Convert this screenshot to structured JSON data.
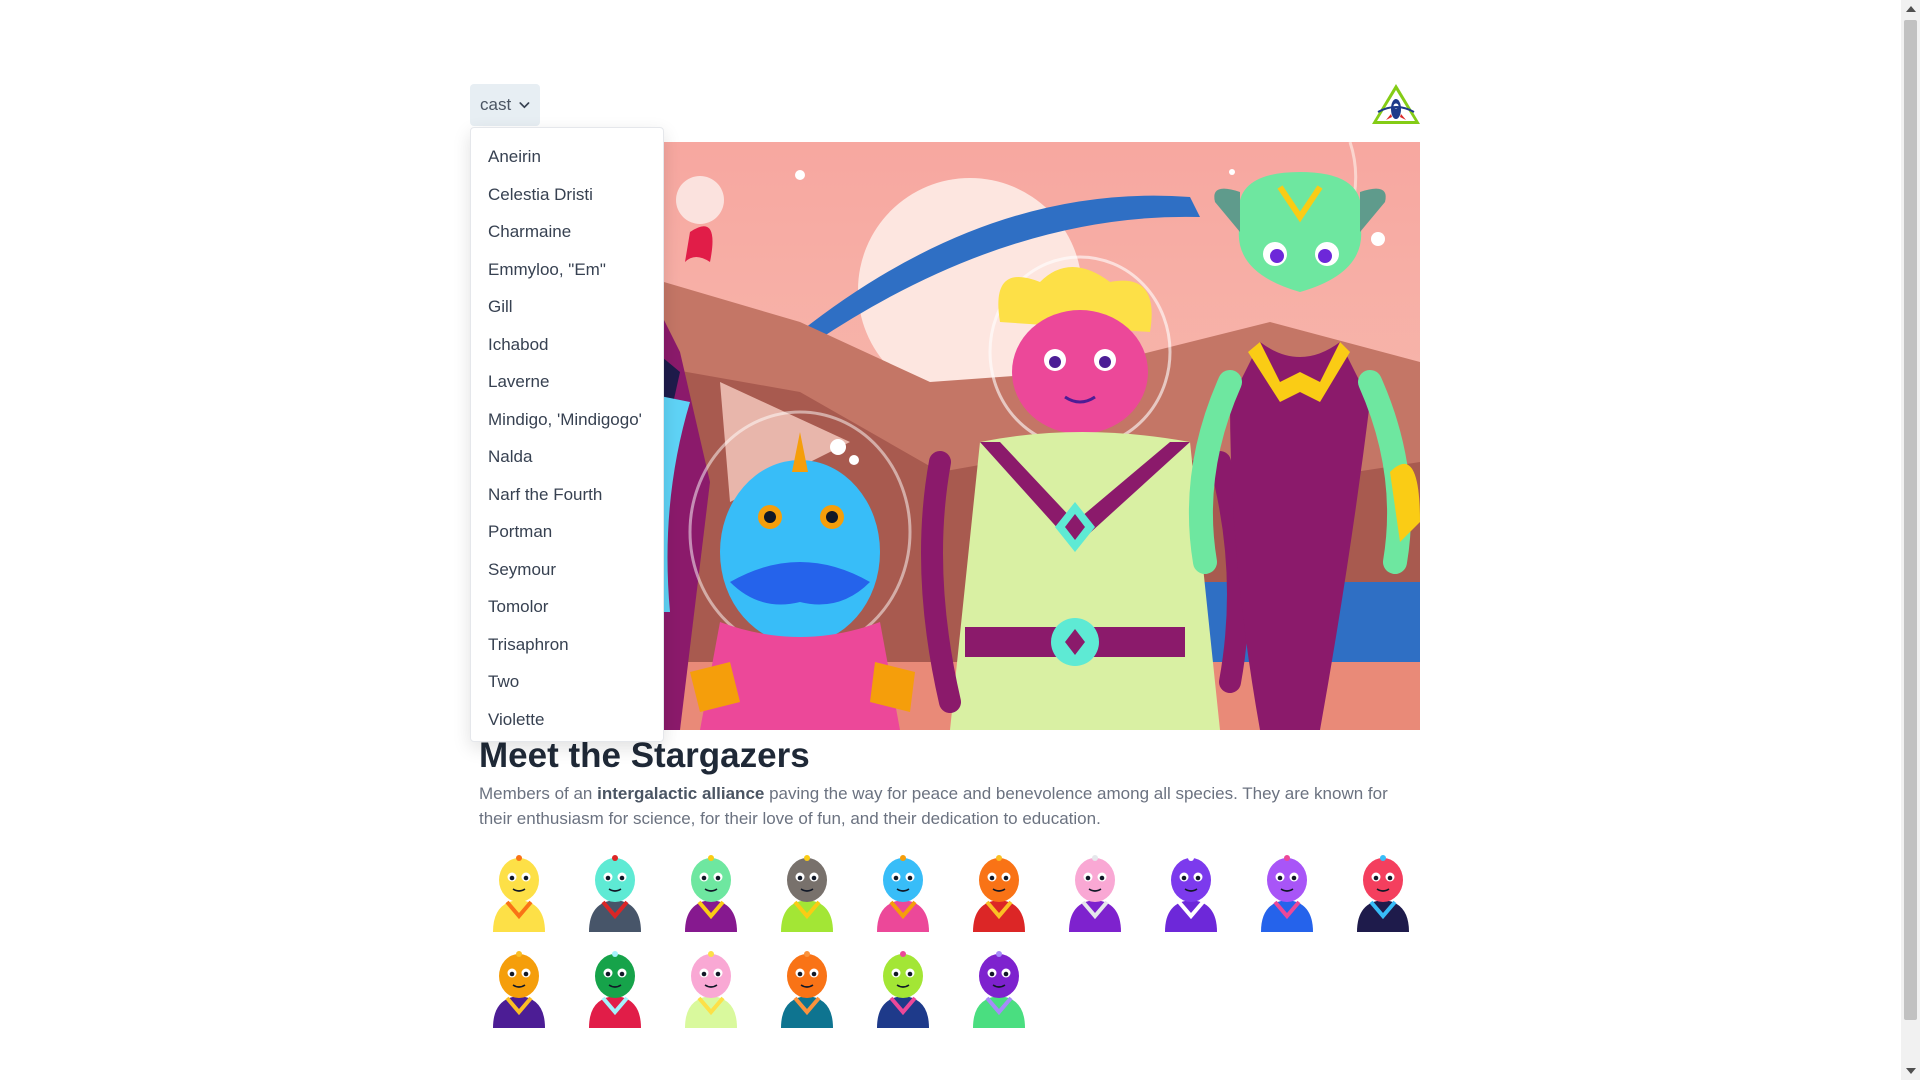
{
  "header": {
    "dropdown_label": "cast",
    "logo_icon": "rocket-triangle-logo-icon"
  },
  "cast_menu": {
    "items": [
      "Aneirin",
      "Celestia Dristi",
      "Charmaine",
      "Emmyloo, \"Em\"",
      "Gill",
      "Ichabod",
      "Laverne",
      "Mindigo, 'Mindigogo'",
      "Nalda",
      "Narf the Fourth",
      "Portman",
      "Seymour",
      "Tomolor",
      "Trisaphron",
      "Two",
      "Violette"
    ]
  },
  "main": {
    "title": "Meet the Stargazers",
    "desc_pre": "Members of an ",
    "desc_bold": "intergalactic alliance",
    "desc_post": " paving the way for peace and benevolence among all species. They are known for their enthusiasm for science, for their love of fun, and their dedication to education."
  },
  "colors": {
    "sky": "#f7a08c",
    "planet": "#fde6e0",
    "ring": "#2f6fc4",
    "accent_purple": "#8b1a6b",
    "accent_green": "#6ee7a0"
  },
  "avatars": [
    {
      "name": "avatar-yellow-bubble",
      "body": "#fde047",
      "head": "#fde047",
      "accent": "#f97316"
    },
    {
      "name": "avatar-cyan-cyclops",
      "body": "#475569",
      "head": "#5eead4",
      "accent": "#dc2626"
    },
    {
      "name": "avatar-green-alien",
      "body": "#86198f",
      "head": "#6ee7a0",
      "accent": "#facc15"
    },
    {
      "name": "avatar-brown-hat",
      "body": "#a3e635",
      "head": "#78716c",
      "accent": "#facc15"
    },
    {
      "name": "avatar-blue-fish",
      "body": "#ec4899",
      "head": "#38bdf8",
      "accent": "#f59e0b"
    },
    {
      "name": "avatar-orange-robot",
      "body": "#dc2626",
      "head": "#f97316",
      "accent": "#fbbf24"
    },
    {
      "name": "avatar-pink-dome",
      "body": "#7e22ce",
      "head": "#f9a8d4",
      "accent": "#e5e7eb"
    },
    {
      "name": "avatar-purple-monster",
      "body": "#6d28d9",
      "head": "#7c3aed",
      "accent": "#ffffff"
    },
    {
      "name": "avatar-violet-antenna",
      "body": "#2563eb",
      "head": "#a855f7",
      "accent": "#ec4899"
    },
    {
      "name": "avatar-red-cyclops",
      "body": "#1e1b4b",
      "head": "#f43f5e",
      "accent": "#38bdf8"
    },
    {
      "name": "avatar-orange-big-ears",
      "body": "#4c1d95",
      "head": "#f59e0b",
      "accent": "#fbbf24"
    },
    {
      "name": "avatar-green-helmet",
      "body": "#e11d48",
      "head": "#16a34a",
      "accent": "#a5f3fc"
    },
    {
      "name": "avatar-pink-blonde",
      "body": "#d9f99d",
      "head": "#f9a8d4",
      "accent": "#fde047"
    },
    {
      "name": "avatar-orange-stalks",
      "body": "#0e7490",
      "head": "#f97316",
      "accent": "#fb923c"
    },
    {
      "name": "avatar-lime-frills",
      "body": "#1e3a8a",
      "head": "#a3e635",
      "accent": "#ec4899"
    },
    {
      "name": "avatar-purple-tall",
      "body": "#4ade80",
      "head": "#7e22ce",
      "accent": "#a78bfa"
    }
  ]
}
